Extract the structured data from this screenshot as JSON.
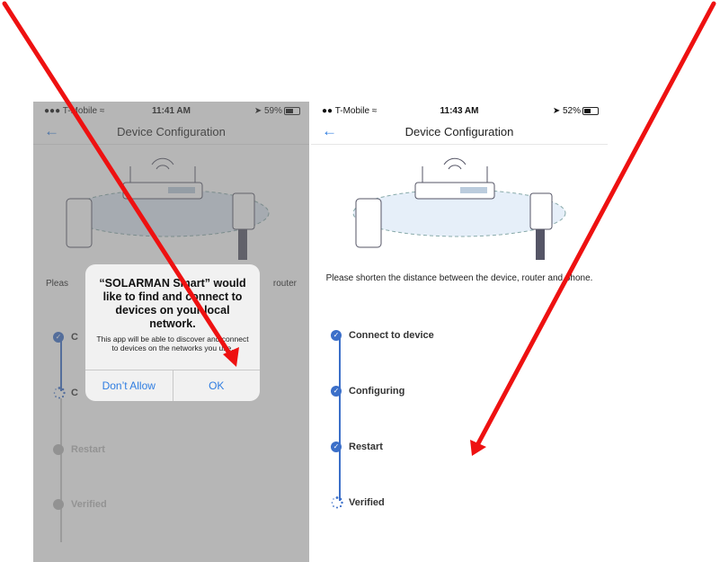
{
  "left_phone": {
    "status": {
      "carrier": "T-Mobile",
      "time": "11:41 AM",
      "battery": "59%"
    },
    "nav": {
      "title": "Device Configuration"
    },
    "hint_left": "Pleas",
    "hint_right": "router",
    "steps": [
      {
        "label": "C",
        "state": "done"
      },
      {
        "label": "C",
        "state": "loading"
      },
      {
        "label": "Restart",
        "state": "pending"
      },
      {
        "label": "Verified",
        "state": "pending"
      }
    ],
    "alert": {
      "title": "“SOLARMAN Smart” would like to find and connect to devices on your local network.",
      "message": "This app will be able to discover and connect to devices on the networks you use.",
      "deny_label": "Don’t Allow",
      "ok_label": "OK"
    }
  },
  "right_phone": {
    "status": {
      "carrier": "T-Mobile",
      "time": "11:43 AM",
      "battery": "52%"
    },
    "nav": {
      "title": "Device Configuration"
    },
    "hint": "Please shorten the distance between the device, router and phone.",
    "steps": [
      {
        "label": "Connect to device",
        "state": "done"
      },
      {
        "label": "Configuring",
        "state": "done"
      },
      {
        "label": "Restart",
        "state": "done"
      },
      {
        "label": "Verified",
        "state": "loading"
      }
    ]
  },
  "colors": {
    "accent": "#2f7de1",
    "step": "#3b6fc9",
    "arrow": "#ee1111",
    "pending": "#b7b7b7"
  },
  "icons": {
    "back": "back-arrow-icon",
    "done": "check-circle-icon",
    "loading": "spinner-icon",
    "wifi": "wifi-icon",
    "battery": "battery-icon",
    "location": "location-arrow-icon"
  }
}
